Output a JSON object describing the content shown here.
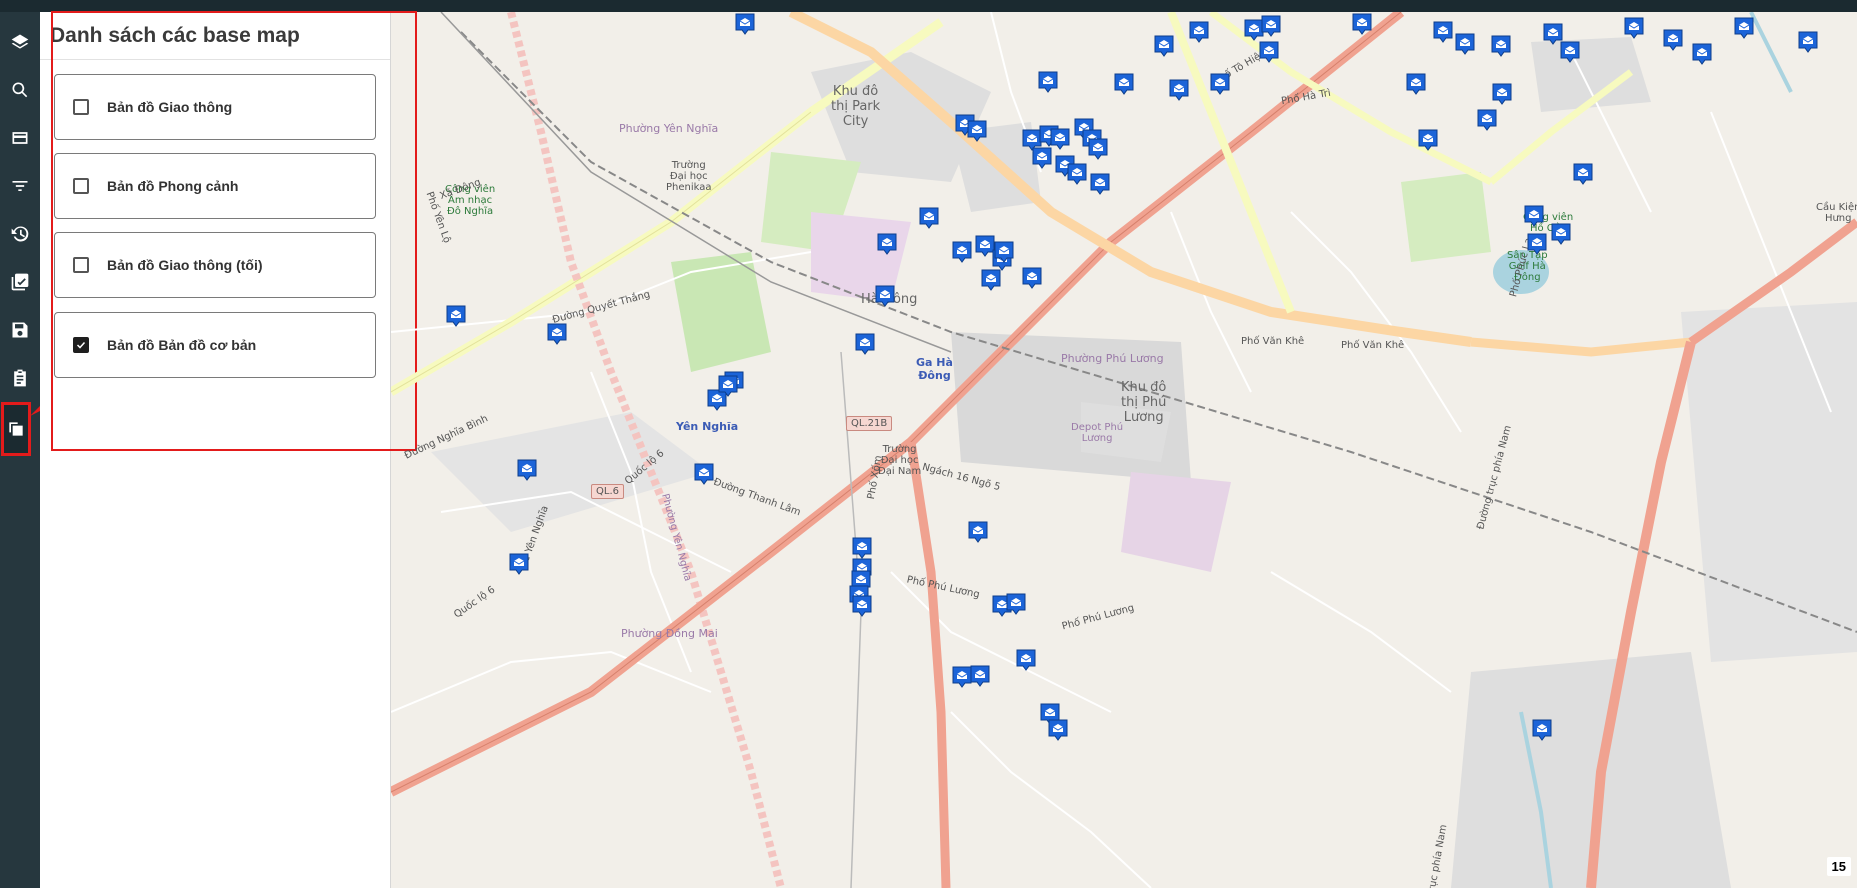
{
  "panel": {
    "title": "Danh sách các base map",
    "options": [
      {
        "label": "Bản đồ Giao thông",
        "checked": false
      },
      {
        "label": "Bản đồ Phong cảnh",
        "checked": false
      },
      {
        "label": "Bản đồ Giao thông (tối)",
        "checked": false
      },
      {
        "label": "Bản đồ Bản đồ cơ bản",
        "checked": true
      }
    ]
  },
  "sidebar": {
    "items": [
      "layers-icon",
      "search-icon",
      "card-icon",
      "filter-icon",
      "history-icon",
      "checklist-icon",
      "save-icon",
      "clipboard-icon",
      "basemap-icon"
    ]
  },
  "map": {
    "zoom_level": "15",
    "labels": {
      "khu_do_thi_park": "Khu đô\nthị Park\nCity",
      "ha_dong": "Hà Đông",
      "ga_ha_dong": "Ga Hà\nĐông",
      "yen_nghia": "Yên Nghĩa",
      "pho_van_khe_1": "Phố Văn Khê",
      "pho_van_khe_2": "Phố Văn Khê",
      "phuong_phu_luong": "Phường Phú Lương",
      "khu_do_thi_phu_luong": "Khu đô\nthị Phú\nLương",
      "depot": "Depot Phú\nLương",
      "truong_phenikaa": "Trường\nĐại học\nPhenikaa",
      "truong_dai_nam": "Trường\nĐại học\nĐại Nam",
      "cong_vien_am_nhac": "Công viên\nÂm nhạc\nĐô Nghĩa",
      "cong_vien_ho_cau": "Công viên\nHồ Cầu",
      "san_tap_golf": "Sân Tập\nGolf Hà\nĐông",
      "cau_kien_hung": "Cầu Kiện\nHưng",
      "phuong_yen_nghia": "Phường Yên Nghĩa",
      "phuong_dong_mai": "Phường Đồng Mai",
      "pho_phu_luong": "Phố Phú Lương",
      "pho_phu_luong_2": "Phố Phú Lương",
      "quoc_lo_6": "Quốc lộ 6",
      "quoc_lo_6b": "Quốc lộ 6",
      "ql6": "QL.6",
      "ql21b": "QL.21B",
      "pho_xom": "Phố Xốm",
      "duong_to_hieu": "Phố Tô Hiệu",
      "pho_ha_tri": "Phố Hà Trì",
      "phuong_phuc_la": "Phố Phúc La",
      "duong_truc_phia_nam": "Đường trục phía Nam",
      "duong_truc_phia_nam_2": "Đường trục phía Nam",
      "phuong_yen_nghia_2": "Phường Yên Nghĩa",
      "duong_quyet_thang": "Đường Quyết Thắng",
      "ngach": "Ngách 16 Ngõ 5",
      "duong_thanh_lam": "Đường Thanh Lâm",
      "de_yen_nghia": "Đê Yên Nghĩa",
      "pho_yen_lo": "Phố Yên Lộ",
      "duong_nghia_binh": "Đường Nghĩa Bình",
      "xa_dong": "Xã Đông"
    }
  },
  "colors": {
    "sidebar_bg": "#26373e",
    "highlight": "#e31b1b",
    "pin": "#1c64d8"
  }
}
